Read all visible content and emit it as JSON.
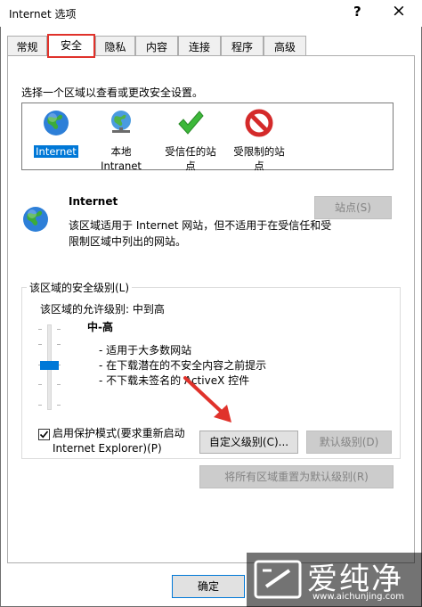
{
  "window": {
    "title": "Internet 选项",
    "help": "?",
    "close": "×"
  },
  "tabs": [
    {
      "label": "常规"
    },
    {
      "label": "安全",
      "active": true
    },
    {
      "label": "隐私"
    },
    {
      "label": "内容"
    },
    {
      "label": "连接"
    },
    {
      "label": "程序"
    },
    {
      "label": "高级"
    }
  ],
  "instruction": "选择一个区域以查看或更改安全设置。",
  "zones": [
    {
      "label": "Internet",
      "icon": "globe-icon",
      "selected": true
    },
    {
      "label": "本地\nIntranet",
      "icon": "intranet-globe-icon"
    },
    {
      "label": "受信任的站\n点",
      "icon": "green-check-icon"
    },
    {
      "label": "受限制的站\n点",
      "icon": "restricted-icon"
    }
  ],
  "selected_zone": {
    "name": "Internet",
    "description": "该区域适用于 Internet 网站，但不适用于在受信任和受限制区域中列出的网站。",
    "sites_button": "站点(S)"
  },
  "security_level": {
    "group_title": "该区域的安全级别(L)",
    "allowed": "该区域的允许级别: 中到高",
    "level_name": "中-高",
    "bullets": [
      "- 适用于大多数网站",
      "- 在下载潜在的不安全内容之前提示",
      "- 不下载未签名的 ActiveX 控件"
    ],
    "slider_level": "中-高",
    "protected_mode_label": "启用保护模式(要求重新启动\nInternet Explorer)(P)",
    "protected_mode_checked": true,
    "custom_button": "自定义级别(C)...",
    "default_button": "默认级别(D)"
  },
  "reset_all_button": "将所有区域重置为默认级别(R)",
  "ok_button": "确定",
  "watermark": {
    "text": "爱纯净",
    "url": "www.aichunjing.com"
  },
  "colors": {
    "highlight_box": "#e0322b",
    "arrow": "#e0322b",
    "selection": "#0078d7"
  }
}
